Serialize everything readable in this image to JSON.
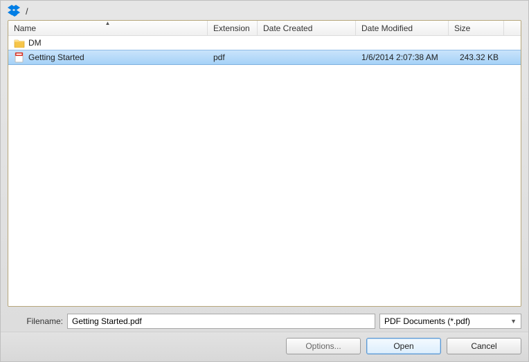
{
  "path": "/",
  "columns": {
    "name": "Name",
    "extension": "Extension",
    "created": "Date Created",
    "modified": "Date Modified",
    "size": "Size"
  },
  "rows": [
    {
      "type": "folder",
      "name": "DM",
      "ext": "",
      "created": "",
      "modified": "",
      "size": "",
      "selected": false
    },
    {
      "type": "pdf",
      "name": "Getting Started",
      "ext": "pdf",
      "created": "",
      "modified": "1/6/2014 2:07:38 AM",
      "size": "243.32 KB",
      "selected": true
    }
  ],
  "filenameLabel": "Filename:",
  "filenameValue": "Getting Started.pdf",
  "filetype": "PDF Documents (*.pdf)",
  "buttons": {
    "options": "Options...",
    "open": "Open",
    "cancel": "Cancel"
  }
}
